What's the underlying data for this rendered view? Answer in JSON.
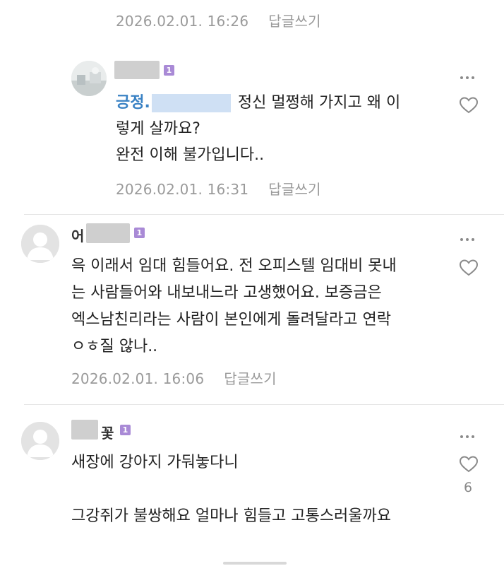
{
  "comments": [
    {
      "id": "top",
      "timestamp": "2026.02.01. 16:26",
      "reply_label": "답글쓰기"
    },
    {
      "id": "reply-1",
      "badge": "1",
      "mention": "긍정.",
      "lines": [
        "정신 멀쩡해 가지고 왜 이",
        "렇게 살까요?",
        "완전 이해 불가입니다.."
      ],
      "timestamp": "2026.02.01. 16:31",
      "reply_label": "답글쓰기"
    },
    {
      "id": "comment-2",
      "nick_prefix": "어",
      "badge": "1",
      "lines": [
        "윽 이래서 임대 힘들어요. 전 오피스텔 임대비 못내",
        "는 사람들어와 내보내느라 고생했어요. 보증금은",
        "엑스남친리라는 사람이 본인에게 돌려달라고 연락",
        "ㅇㅎ질 않나.."
      ],
      "timestamp": "2026.02.01. 16:06",
      "reply_label": "답글쓰기"
    },
    {
      "id": "comment-3",
      "nick_suffix": "꽃",
      "badge": "1",
      "lines": [
        "새장에 강아지 가둬놓다니",
        "",
        "그강쥐가 불쌍해요 얼마나 힘들고 고통스러울까요"
      ],
      "like_count": "6"
    }
  ],
  "icons": {
    "more": "more-dots-icon",
    "like": "heart-outline-icon"
  },
  "colors": {
    "meta": "#9a9a9a",
    "badge": "#a98ad6",
    "mention": "#3a82c4"
  }
}
